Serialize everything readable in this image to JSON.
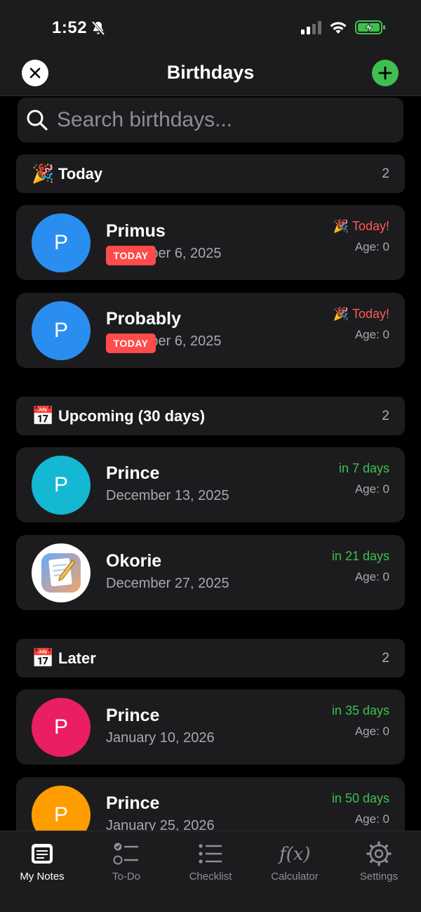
{
  "status": {
    "time": "1:52"
  },
  "header": {
    "title": "Birthdays"
  },
  "search": {
    "placeholder": "Search birthdays..."
  },
  "sections": [
    {
      "emoji": "🎉",
      "label": "Today",
      "count": "2",
      "items": [
        {
          "initial": "P",
          "name": "Primus",
          "date": "December 6, 2025",
          "badge": "TODAY",
          "countdown": "🎉 Today!",
          "age": "Age: 0",
          "color": "#2a8ef0"
        },
        {
          "initial": "P",
          "name": "Probably",
          "date": "December 6, 2025",
          "badge": "TODAY",
          "countdown": "🎉 Today!",
          "age": "Age: 0",
          "color": "#2a8ef0"
        }
      ]
    },
    {
      "emoji": "📅",
      "label": "Upcoming (30 days)",
      "count": "2",
      "items": [
        {
          "initial": "P",
          "name": "Prince",
          "date": "December 13, 2025",
          "countdown": "in 7 days",
          "age": "Age: 0",
          "color": "#14b8d2"
        },
        {
          "initial": "",
          "name": "Okorie",
          "date": "December 27, 2025",
          "countdown": "in 21 days",
          "age": "Age: 0",
          "color": "#ffffff",
          "image": "notes-app-icon"
        }
      ]
    },
    {
      "emoji": "📅",
      "label": "Later",
      "count": "2",
      "items": [
        {
          "initial": "P",
          "name": "Prince",
          "date": "January 10, 2026",
          "countdown": "in 35 days",
          "age": "Age: 0",
          "color": "#e91e63"
        },
        {
          "initial": "P",
          "name": "Prince",
          "date": "January 25, 2026",
          "countdown": "in 50 days",
          "age": "Age: 0",
          "color": "#ff9d00"
        }
      ]
    }
  ],
  "tabs": [
    {
      "label": "My Notes",
      "icon": "notes-icon",
      "active": true
    },
    {
      "label": "To-Do",
      "icon": "todo-icon"
    },
    {
      "label": "Checklist",
      "icon": "checklist-icon"
    },
    {
      "label": "Calculator",
      "icon": "function-icon"
    },
    {
      "label": "Settings",
      "icon": "gear-icon"
    }
  ],
  "colors": {
    "accent_green": "#3fbf4f",
    "today_red": "#ff4b4b",
    "card_bg": "#1c1c1e"
  }
}
